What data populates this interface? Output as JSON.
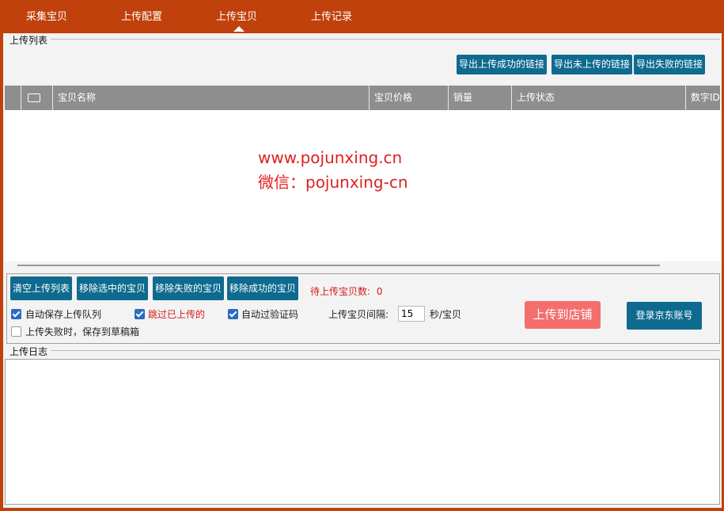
{
  "nav": {
    "tabs": [
      {
        "label": "采集宝贝"
      },
      {
        "label": "上传配置"
      },
      {
        "label": "上传宝贝"
      },
      {
        "label": "上传记录"
      }
    ],
    "active_tab": "上传宝贝"
  },
  "upload_list": {
    "title": "上传列表",
    "export_buttons": [
      "导出上传成功的链接",
      "导出未上传的链接",
      "导出失败的链接"
    ],
    "columns": [
      "宝贝名称",
      "宝贝价格",
      "销量",
      "上传状态",
      "数字ID"
    ],
    "rows": []
  },
  "watermark": {
    "line1": "www.pojunxing.cn",
    "line2": "微信：pojunxing-cn"
  },
  "actions": {
    "buttons": [
      "清空上传列表",
      "移除选中的宝贝",
      "移除失败的宝贝",
      "移除成功的宝贝"
    ],
    "pending_label": "待上传宝贝数:",
    "pending_count": "0"
  },
  "options": {
    "auto_save_queue": {
      "label": "自动保存上传队列",
      "checked": true
    },
    "skip_uploaded": {
      "label": "跳过已上传的",
      "checked": true
    },
    "auto_captcha": {
      "label": "自动过验证码",
      "checked": true
    },
    "save_draft_on_fail": {
      "label": "上传失败时，保存到草稿箱",
      "checked": false
    },
    "interval_label": "上传宝贝间隔:",
    "interval_value": "15",
    "interval_unit": "秒/宝贝"
  },
  "buttons": {
    "upload_to_store": "上传到店铺",
    "login_jd": "登录京东账号"
  },
  "upload_log": {
    "title": "上传日志"
  },
  "colors": {
    "brand": "#c0410b",
    "button_blue": "#0e6a8f",
    "upload_button": "#f46e6e",
    "warning_red": "#d41c1c",
    "checkbox_blue": "#2a6bc4"
  }
}
